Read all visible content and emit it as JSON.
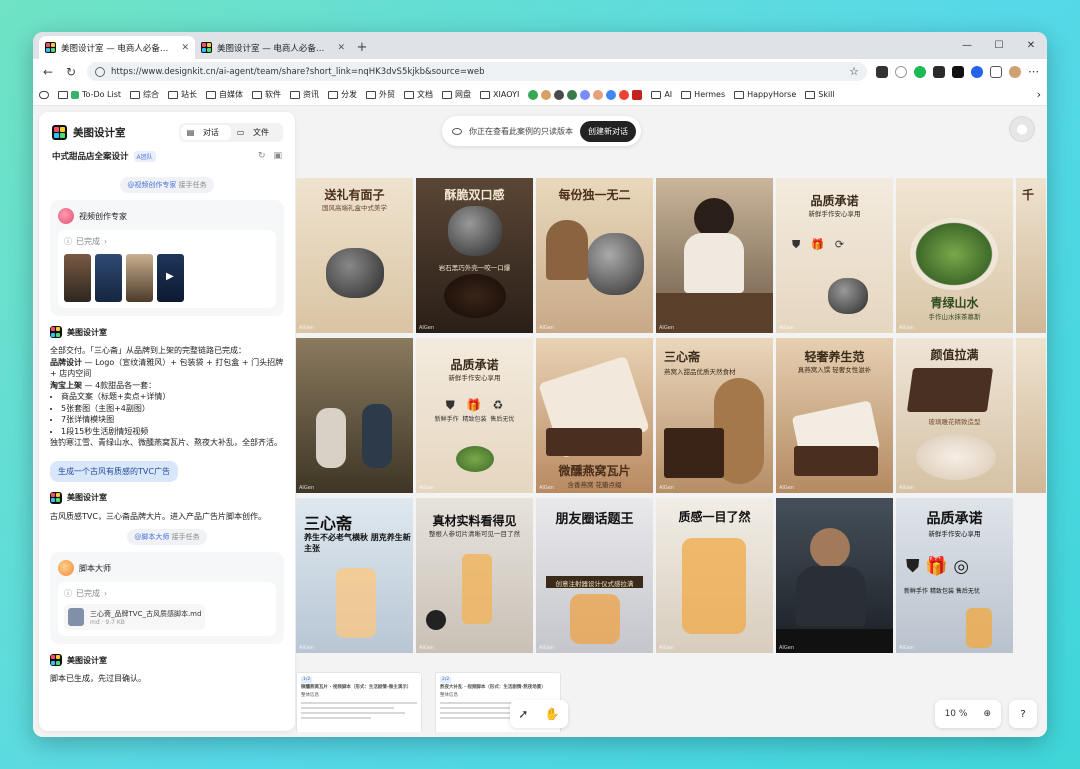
{
  "browser": {
    "tabs": [
      {
        "title": "美图设计室 — 电商人必备的设计 /",
        "active": true
      },
      {
        "title": "美图设计室 — 电商人必备的设计 /",
        "active": false
      }
    ],
    "url": "https://www.designkit.cn/ai-agent/team/share?short_link=nqHK3dvS5kjkb&source=web",
    "bookmarks": [
      "To-Do List",
      "综合",
      "站长",
      "自媒体",
      "软件",
      "资讯",
      "分发",
      "外贸",
      "文档",
      "网盘",
      "XIAOYI",
      "AI",
      "Hermes",
      "HappyHorse",
      "Skill"
    ]
  },
  "sidebar": {
    "brand": "美图设计室",
    "toggle_chat": "对话",
    "toggle_files": "文件",
    "project_name": "中式甜品店全案设计",
    "project_badge": "A团队",
    "pill1_name": "@视频创作专家",
    "pill1_rest": " 接手任务",
    "video_expert": "视频创作专家",
    "status_done": "已完成",
    "assistant_name": "美图设计室",
    "summary_intro": "全部交付。「三心斋」从品牌到上架的完整链路已完成：",
    "brand_design_label": "品牌设计",
    "brand_design_text": " — Logo（宣纹清雅风）+ 包装袋 + 打包盒 + 门头招牌 + 店内空间",
    "taobao_label": "淘宝上架",
    "taobao_text": " — 4款甜品各一套：",
    "bullets": [
      "商品文案（标题+卖点+详情）",
      "5张套图（主图+4副图）",
      "7张详情模块图",
      "1段15秒生活剧情短视频"
    ],
    "summary_outro": "独钓寒江雪、青绿山水、微醺燕窝瓦片、熬夜大补乱，全部齐活。",
    "user_msg": "生成一个古风有质感的TVC广告",
    "reply2": "古风质感TVC，三心斋品牌大片。进入产品广告片脚本创作。",
    "pill2_name": "@脚本大师",
    "pill2_rest": " 接手任务",
    "script_master": "脚本大师",
    "file_name": "三心斋_品牌TVC_古风质感脚本.md",
    "file_size": "md · 9.7 KB",
    "final_reply": "脚本已生成，先过目确认。"
  },
  "canvas": {
    "readonly_notice": "你正在查看此案例的只读版本",
    "new_chat_button": "创建新对话",
    "zoom": "10",
    "zoom_unit": "%",
    "ai_watermark": "AIGen",
    "tiles": [
      {
        "title": "送礼有面子",
        "sub": "国风高端礼盒中式美学"
      },
      {
        "title": "酥脆双口感",
        "sub": "岩石黑巧外壳一咬一口爆"
      },
      {
        "title": "每份独一无二",
        "sub": ""
      },
      {
        "title": "",
        "sub": ""
      },
      {
        "title": "品质承诺",
        "sub": "新鲜手作安心享用"
      },
      {
        "title": "千",
        "sub": ""
      },
      {
        "title": "",
        "sub": ""
      },
      {
        "title": "品质承诺",
        "sub": "新鲜手作安心享用"
      },
      {
        "title": "",
        "sub": "微醺燕窝瓦片"
      },
      {
        "title": "三心斋",
        "sub": "燕窝入甜品优质天然食材"
      },
      {
        "title": "轻奢养生范",
        "sub": "真燕窝入馔 轻奢女性滋补"
      },
      {
        "title": "颜值拉满",
        "sub": "玻璃雕花精致造型"
      },
      {
        "title": "三心斋",
        "sub": "养生不必老气横秋 朋克养生新主张"
      },
      {
        "title": "真材实料看得见",
        "sub": "整根人参切片清晰可见一目了然"
      },
      {
        "title": "朋友圈话题王",
        "sub": "创意注射器设计仪式感拉满"
      },
      {
        "title": "质感一目了然",
        "sub": ""
      },
      {
        "title": "",
        "sub": ""
      },
      {
        "title": "品质承诺",
        "sub": "新鲜手作安心享用"
      },
      {
        "title": "青绿山水",
        "sub": "手作山水抹茶慕斯"
      },
      {
        "title": "微醺燕窝瓦片",
        "sub": "含香燕窝 花瓣点缀"
      }
    ],
    "promise_icons": [
      "新鲜手作",
      "精致包装",
      "售后无忧"
    ],
    "doc1_tag": "1/2",
    "doc1_title": "微醺燕窝瓦片 · 视频脚本（形式：生活剧情-微主演示）",
    "doc2_tag": "2/2",
    "doc2_title": "熬夜大补乱 · 视频脚本（形式：生活剧情-熬夜场景）",
    "doc_section": "整体信息"
  }
}
